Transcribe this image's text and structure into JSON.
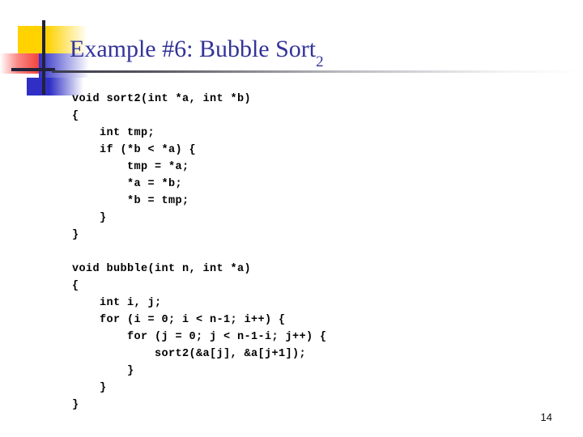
{
  "slide": {
    "title_main": "Example #6: Bubble Sort",
    "title_subscript": "2",
    "page_number": "14",
    "colors": {
      "title": "#333399",
      "logo_yellow": "#ffd200",
      "logo_red": "#f4423c",
      "logo_blue": "#2f2fc6",
      "logo_bar": "#22223a",
      "code_text": "#000000",
      "background": "#ffffff"
    }
  },
  "code": {
    "language": "c",
    "lines": [
      "void sort2(int *a, int *b)",
      "{",
      "    int tmp;",
      "    if (*b < *a) {",
      "        tmp = *a;",
      "        *a = *b;",
      "        *b = tmp;",
      "    }",
      "}",
      "",
      "void bubble(int n, int *a)",
      "{",
      "    int i, j;",
      "    for (i = 0; i < n-1; i++) {",
      "        for (j = 0; j < n-1-i; j++) {",
      "            sort2(&a[j], &a[j+1]);",
      "        }",
      "    }",
      "}"
    ]
  }
}
